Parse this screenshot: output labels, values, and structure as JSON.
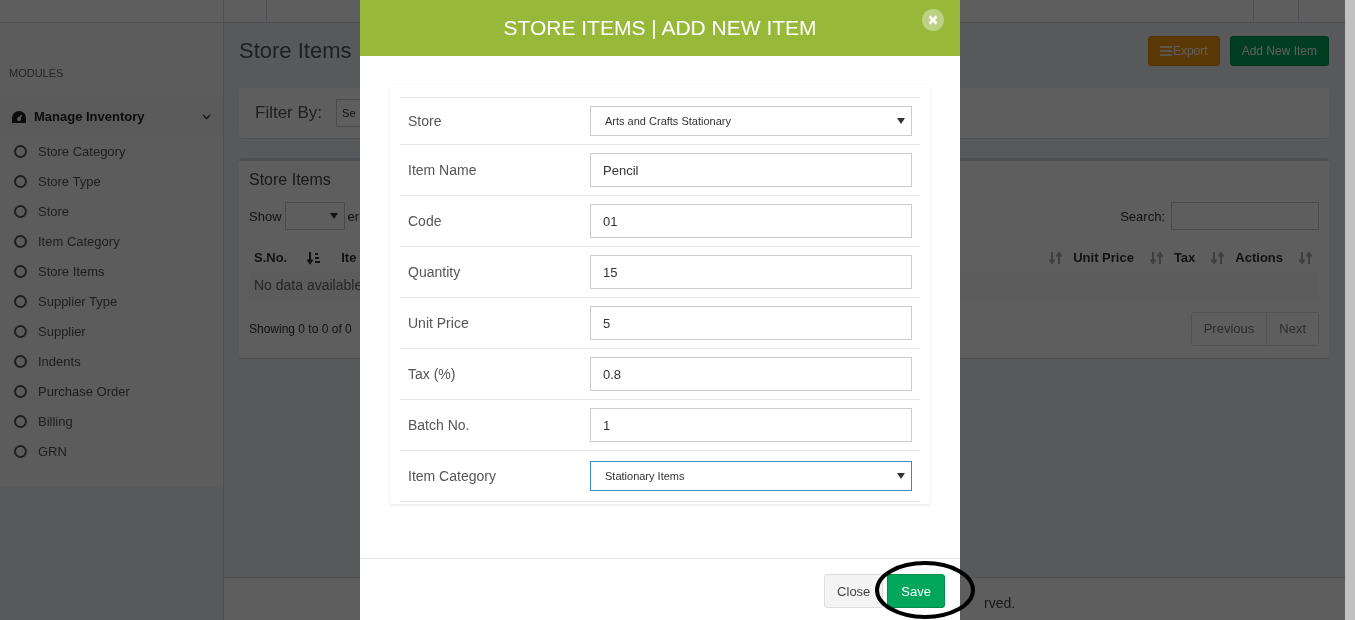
{
  "sidebar": {
    "heading": "MODULES",
    "group": {
      "label": "Manage Inventory",
      "expanded": true
    },
    "items": [
      "Store Category",
      "Store Type",
      "Store",
      "Item Category",
      "Store Items",
      "Supplier Type",
      "Supplier",
      "Indents",
      "Purchase Order",
      "Billing",
      "GRN"
    ]
  },
  "page": {
    "title": "Store Items",
    "buttons": [
      {
        "label": "Export",
        "kind": "export"
      },
      {
        "label": "Add New Item",
        "kind": "add"
      }
    ],
    "filter": {
      "label": "Filter By:",
      "select_value": "Se"
    },
    "table_card": {
      "title": "Store Items",
      "show_label": "Show",
      "entries_fragment": "er",
      "search_label": "Search:",
      "left_columns": [
        {
          "label": "S.No.",
          "sorted": true
        },
        {
          "label": "Ite",
          "sorted": false
        }
      ],
      "right_columns": [
        "Unit Price",
        "Tax",
        "Actions"
      ],
      "empty_text": "No data available",
      "info": "Showing 0 to 0 of 0",
      "pagination": [
        "Previous",
        "Next"
      ]
    }
  },
  "footer": {
    "text": "rved."
  },
  "modal": {
    "title": "STORE ITEMS | ADD NEW ITEM",
    "fields": [
      {
        "label": "Store",
        "kind": "select",
        "value": "Arts and Crafts Stationary",
        "focused": false
      },
      {
        "label": "Item Name",
        "kind": "text",
        "value": "Pencil",
        "focused": false
      },
      {
        "label": "Code",
        "kind": "text",
        "value": "01",
        "focused": false
      },
      {
        "label": "Quantity",
        "kind": "text",
        "value": "15",
        "focused": false
      },
      {
        "label": "Unit Price",
        "kind": "text",
        "value": "5",
        "focused": false
      },
      {
        "label": "Tax (%)",
        "kind": "text",
        "value": "0.8",
        "focused": false
      },
      {
        "label": "Batch No.",
        "kind": "text",
        "value": "1",
        "focused": false
      },
      {
        "label": "Item Category",
        "kind": "select",
        "value": "Stationary Items",
        "focused": true
      }
    ],
    "buttons": [
      {
        "label": "Close",
        "kind": "default"
      },
      {
        "label": "Save",
        "kind": "primary"
      }
    ]
  }
}
